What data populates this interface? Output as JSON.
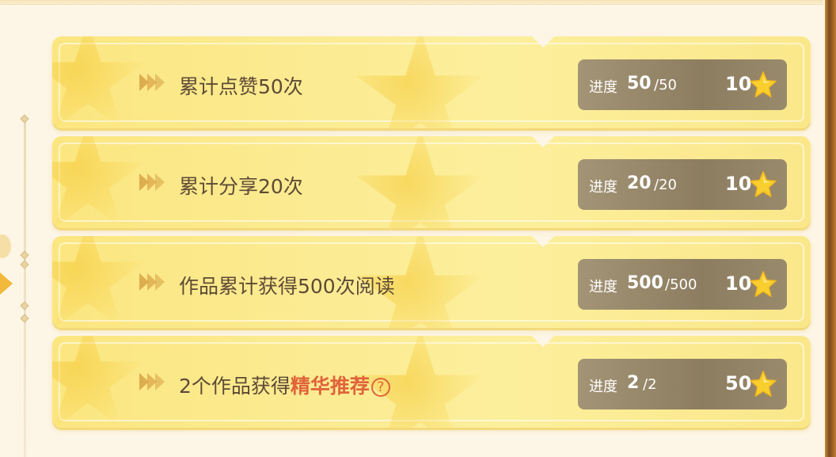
{
  "tasks": [
    {
      "title_plain": "累计点赞50次",
      "title_highlight": "",
      "progress_label": "进度",
      "progress_current": "50",
      "progress_total": "/50",
      "reward": "10"
    },
    {
      "title_plain": "累计分享20次",
      "title_highlight": "",
      "progress_label": "进度",
      "progress_current": "20",
      "progress_total": "/20",
      "reward": "10"
    },
    {
      "title_plain": "作品累计获得500次阅读",
      "title_highlight": "",
      "progress_label": "进度",
      "progress_current": "500",
      "progress_total": "/500",
      "reward": "10"
    },
    {
      "title_plain": "2个作品获得",
      "title_highlight": "精华推荐",
      "help_glyph": "?",
      "progress_label": "进度",
      "progress_current": "2",
      "progress_total": "/2",
      "reward": "50"
    }
  ],
  "colors": {
    "card": "#fbe88a",
    "progress_box": "#978768",
    "highlight": "#e0633a",
    "star": "#f9cf2e"
  },
  "icons": {
    "arrow": "chevron-triple-right-icon",
    "reward": "star-icon",
    "help": "question-circle-icon"
  }
}
